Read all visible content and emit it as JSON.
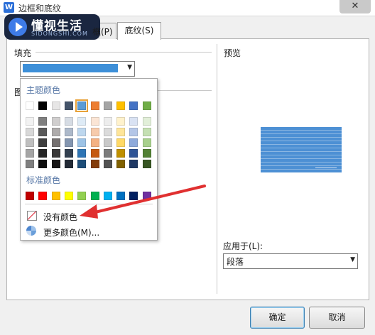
{
  "window": {
    "title": "边框和底纹",
    "app_icon": "W",
    "close_label": "✕"
  },
  "logo": {
    "name": "懂视生活",
    "domain": "SIDONGSHI.COM"
  },
  "tabs": {
    "page_border_partial": "框(P)",
    "shading": "底纹(S)"
  },
  "fill": {
    "label": "填充",
    "selected_color": "#3d8fd8"
  },
  "pattern_label_partial": "图",
  "color_popup": {
    "theme_heading": "主题颜色",
    "theme_colors": [
      "#ffffff",
      "#000000",
      "#e7e6e6",
      "#44546a",
      "#5b9bd5",
      "#ed7d31",
      "#a5a5a5",
      "#ffc000",
      "#4472c4",
      "#70ad47"
    ],
    "theme_selected_index": 4,
    "shade_rows": [
      [
        "#f2f2f2",
        "#7f7f7f",
        "#d0cece",
        "#d6dce4",
        "#deebf6",
        "#fbe5d5",
        "#ededed",
        "#fff2cc",
        "#d9e2f3",
        "#e2efd9"
      ],
      [
        "#d8d8d8",
        "#595959",
        "#aeabab",
        "#adb9ca",
        "#bdd7ee",
        "#f7cbac",
        "#dbdbdb",
        "#fee599",
        "#b4c6e7",
        "#c5e0b3"
      ],
      [
        "#bfbfbf",
        "#3f3f3f",
        "#757070",
        "#8496b0",
        "#9dc3e6",
        "#f4b183",
        "#c9c9c9",
        "#ffd966",
        "#8eaadb",
        "#a8d08d"
      ],
      [
        "#a5a5a5",
        "#262626",
        "#3a3838",
        "#323f4f",
        "#2e75b5",
        "#c55a11",
        "#7b7b7b",
        "#bf9000",
        "#2f5496",
        "#538135"
      ],
      [
        "#7f7f7f",
        "#0d0d0d",
        "#171616",
        "#222a35",
        "#1e4e79",
        "#833c0b",
        "#525252",
        "#7f6000",
        "#1f3864",
        "#375623"
      ]
    ],
    "standard_heading": "标准颜色",
    "standard_colors": [
      "#c00000",
      "#ff0000",
      "#ffc000",
      "#ffff00",
      "#92d050",
      "#00b050",
      "#00b0f0",
      "#0070c0",
      "#002060",
      "#7030a0"
    ],
    "no_color_label": "没有颜色",
    "more_colors_label": "更多颜色(M)...",
    "annotation_arrow_color": "#e03030"
  },
  "preview": {
    "label": "预览"
  },
  "apply_to": {
    "label": "应用于(L):",
    "value": "段落"
  },
  "buttons": {
    "ok": "确定",
    "cancel": "取消"
  }
}
